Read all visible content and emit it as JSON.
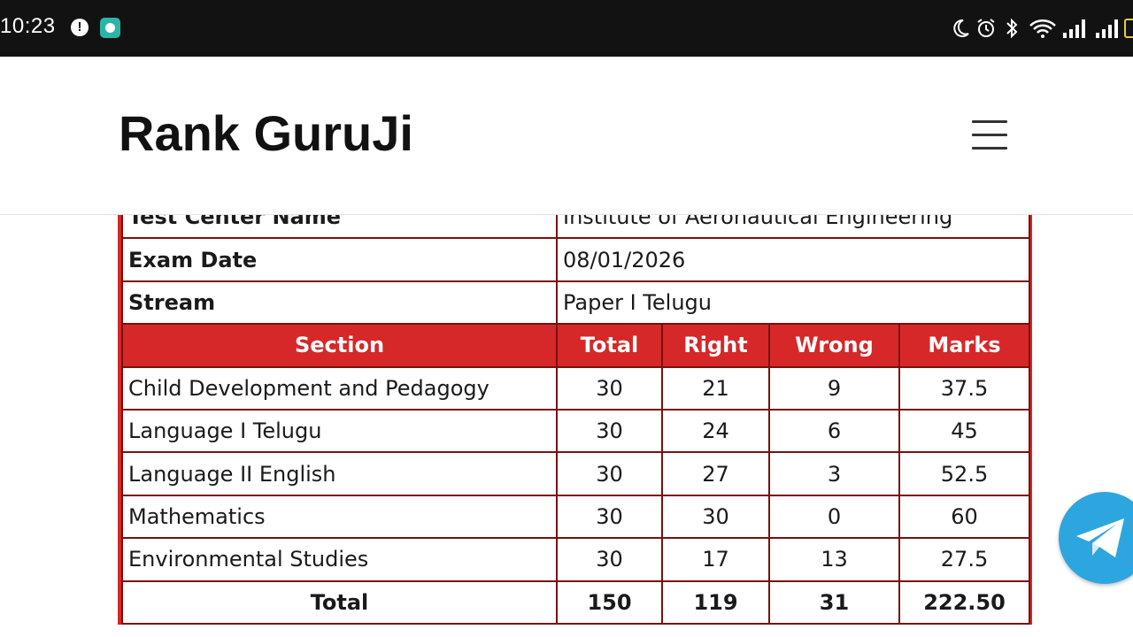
{
  "status_bar": {
    "time": "10:23",
    "icons": [
      "alert-icon",
      "app-notification-icon",
      "moon-icon",
      "alarm-icon",
      "bluetooth-icon",
      "wifi-icon",
      "signal-icon",
      "signal-icon",
      "battery-icon"
    ]
  },
  "header": {
    "title": "Rank GuruJi",
    "menu_icon": "hamburger-menu-icon"
  },
  "info_rows": [
    {
      "label": "Test Center Name",
      "value": "Institute of Aeronautical Engineering"
    },
    {
      "label": "Exam Date",
      "value": "08/01/2026"
    },
    {
      "label": "Stream",
      "value": "Paper I Telugu"
    }
  ],
  "table": {
    "headers": [
      "Section",
      "Total",
      "Right",
      "Wrong",
      "Marks"
    ],
    "rows": [
      [
        "Child Development and Pedagogy",
        "30",
        "21",
        "9",
        "37.5"
      ],
      [
        "Language I Telugu",
        "30",
        "24",
        "6",
        "45"
      ],
      [
        "Language II English",
        "30",
        "27",
        "3",
        "52.5"
      ],
      [
        "Mathematics",
        "30",
        "30",
        "0",
        "60"
      ],
      [
        "Environmental Studies",
        "30",
        "17",
        "13",
        "27.5"
      ]
    ],
    "total": [
      "Total",
      "150",
      "119",
      "31",
      "222.50"
    ]
  },
  "floating_button": {
    "icon": "telegram-icon"
  },
  "colors": {
    "accent": "#d62828",
    "border": "#7a1010",
    "telegram": "#2da6e0"
  }
}
